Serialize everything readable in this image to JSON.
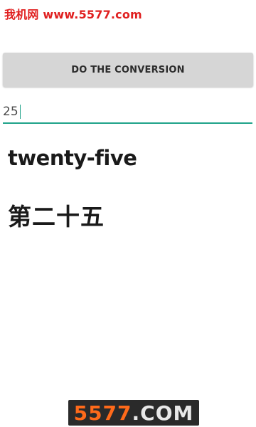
{
  "watermark": {
    "top_text": "我机网 www.5577.com",
    "bottom_number": "5577",
    "bottom_domain": ".COM",
    "top_color": "#e02020",
    "bottom_number_color": "#ff6a1a"
  },
  "converter": {
    "button_label": "DO THE CONVERSION",
    "input_value": "25",
    "english_result": "twenty-five",
    "chinese_result": "第二十五",
    "accent_color": "#1fa38a"
  }
}
